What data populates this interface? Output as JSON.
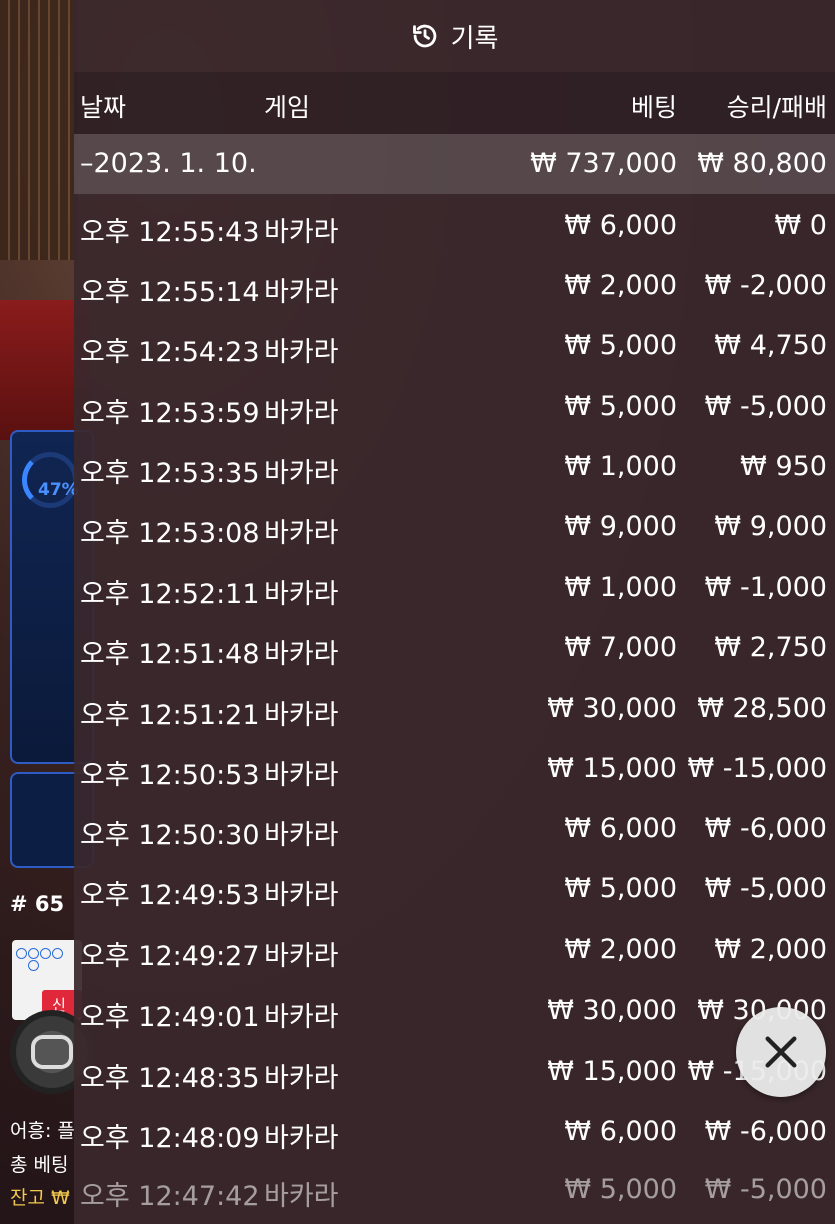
{
  "header": {
    "title": "기록",
    "icon": "history-icon"
  },
  "columns": {
    "date": "날짜",
    "game": "게임",
    "bet": "베팅",
    "result": "승리/패배"
  },
  "summary": {
    "date": "–2023. 1. 10.",
    "bet": "₩ 737,000",
    "result": "₩ 80,800"
  },
  "rows": [
    {
      "time": "오후 12:55:43",
      "game": "바카라",
      "bet": "₩ 6,000",
      "result": "₩ 0"
    },
    {
      "time": "오후 12:55:14",
      "game": "바카라",
      "bet": "₩ 2,000",
      "result": "₩ -2,000"
    },
    {
      "time": "오후 12:54:23",
      "game": "바카라",
      "bet": "₩ 5,000",
      "result": "₩ 4,750"
    },
    {
      "time": "오후 12:53:59",
      "game": "바카라",
      "bet": "₩ 5,000",
      "result": "₩ -5,000"
    },
    {
      "time": "오후 12:53:35",
      "game": "바카라",
      "bet": "₩ 1,000",
      "result": "₩ 950"
    },
    {
      "time": "오후 12:53:08",
      "game": "바카라",
      "bet": "₩ 9,000",
      "result": "₩ 9,000"
    },
    {
      "time": "오후 12:52:11",
      "game": "바카라",
      "bet": "₩ 1,000",
      "result": "₩ -1,000"
    },
    {
      "time": "오후 12:51:48",
      "game": "바카라",
      "bet": "₩ 7,000",
      "result": "₩ 2,750"
    },
    {
      "time": "오후 12:51:21",
      "game": "바카라",
      "bet": "₩ 30,000",
      "result": "₩ 28,500"
    },
    {
      "time": "오후 12:50:53",
      "game": "바카라",
      "bet": "₩ 15,000",
      "result": "₩ -15,000"
    },
    {
      "time": "오후 12:50:30",
      "game": "바카라",
      "bet": "₩ 6,000",
      "result": "₩ -6,000"
    },
    {
      "time": "오후 12:49:53",
      "game": "바카라",
      "bet": "₩ 5,000",
      "result": "₩ -5,000"
    },
    {
      "time": "오후 12:49:27",
      "game": "바카라",
      "bet": "₩ 2,000",
      "result": "₩ 2,000"
    },
    {
      "time": "오후 12:49:01",
      "game": "바카라",
      "bet": "₩ 30,000",
      "result": "₩ 30,000"
    },
    {
      "time": "오후 12:48:35",
      "game": "바카라",
      "bet": "₩ 15,000",
      "result": "₩ -15,000"
    },
    {
      "time": "오후 12:48:09",
      "game": "바카라",
      "bet": "₩ 6,000",
      "result": "₩ -6,000"
    },
    {
      "time": "오후 12:47:42",
      "game": "바카라",
      "bet": "₩ 5,000",
      "result": "₩ -5,000"
    }
  ],
  "background": {
    "progress_percent": "47%",
    "round_number": "# 65",
    "new_badge": "신",
    "label_1": "어흥: 플",
    "label_2": "총 베팅",
    "label_3": "잔고 ₩"
  },
  "close_icon": "close-icon"
}
